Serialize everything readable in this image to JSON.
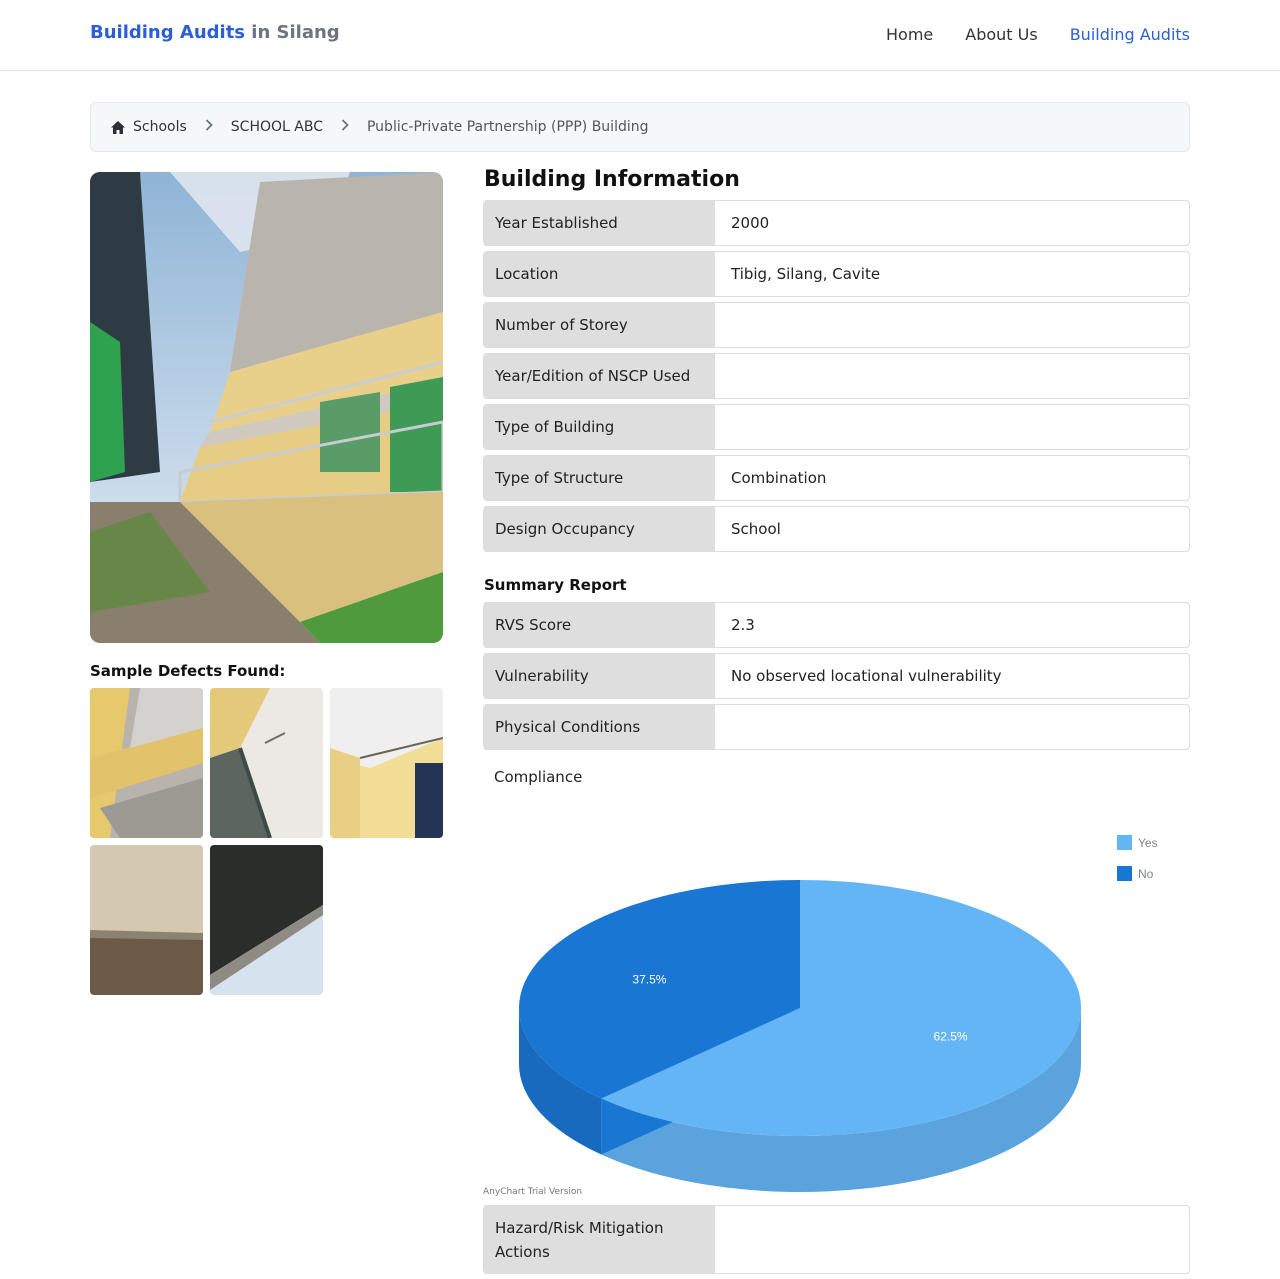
{
  "navbar": {
    "brand_primary": "Building Audits",
    "brand_secondary": " in Silang",
    "links": [
      {
        "label": "Home",
        "active": false
      },
      {
        "label": "About Us",
        "active": false
      },
      {
        "label": "Building Audits",
        "active": true
      }
    ]
  },
  "breadcrumb": {
    "home_icon": "home-icon",
    "items": [
      "Schools",
      "SCHOOL ABC",
      "Public-Private Partnership (PPP) Building"
    ]
  },
  "left": {
    "defects_title": "Sample Defects Found:"
  },
  "building_info": {
    "title": "Building Information",
    "rows": [
      {
        "label": "Year Established",
        "value": "2000"
      },
      {
        "label": "Location",
        "value": "Tibig, Silang, Cavite"
      },
      {
        "label": "Number of Storey",
        "value": ""
      },
      {
        "label": "Year/Edition of NSCP Used",
        "value": ""
      },
      {
        "label": "Type of Building",
        "value": ""
      },
      {
        "label": "Type of Structure",
        "value": "Combination"
      },
      {
        "label": "Design Occupancy",
        "value": "School"
      }
    ]
  },
  "summary": {
    "title": "Summary Report",
    "rows": [
      {
        "label": "RVS Score",
        "value": "2.3"
      },
      {
        "label": "Vulnerability",
        "value": "No observed locational vulnerability"
      },
      {
        "label": "Physical Conditions",
        "value": ""
      }
    ],
    "compliance_label": "Compliance",
    "mitigation": {
      "label": "Hazard/Risk Mitigation Actions",
      "value": ""
    }
  },
  "chart_data": {
    "type": "pie",
    "categories": [
      "Yes",
      "No"
    ],
    "values": [
      62.5,
      37.5
    ],
    "value_labels": [
      "62.5%",
      "37.5%"
    ],
    "colors": {
      "Yes": "#64b5f6",
      "No": "#1976d2"
    },
    "legend_position": "top-right",
    "credit": "AnyChart Trial Version"
  }
}
